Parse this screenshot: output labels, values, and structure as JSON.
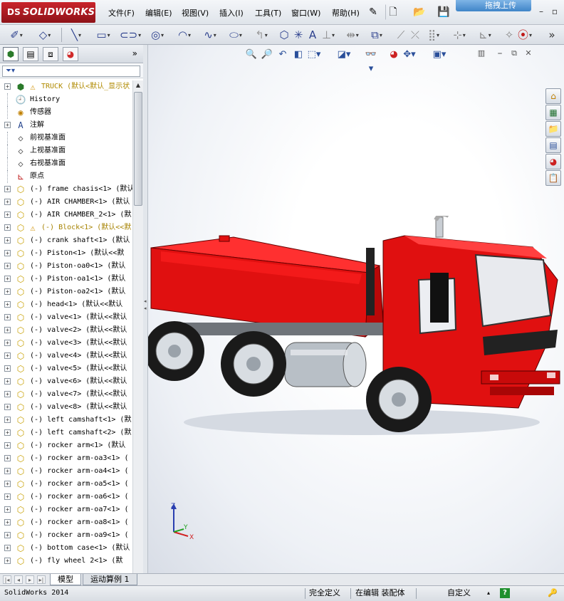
{
  "app": {
    "logo_text": "SOLIDWORKS",
    "logo_mark": "DS",
    "menu": [
      "文件(F)",
      "编辑(E)",
      "视图(V)",
      "插入(I)",
      "工具(T)",
      "窗口(W)",
      "帮助(H)"
    ],
    "upload_label": "拖拽上传"
  },
  "panel": {
    "tabs": [
      "feature-manager",
      "property-manager",
      "configuration-manager",
      "display-manager"
    ],
    "tree": [
      {
        "label": "TRUCK  (默认<默认_显示状",
        "icon": "assembly-icon",
        "warn": true,
        "root": true
      },
      {
        "label": "History",
        "icon": "history-icon"
      },
      {
        "label": "传感器",
        "icon": "sensor-icon"
      },
      {
        "label": "注解",
        "icon": "annotation-icon",
        "expand": true
      },
      {
        "label": "前视基准面",
        "icon": "plane-icon"
      },
      {
        "label": "上视基准面",
        "icon": "plane-icon"
      },
      {
        "label": "右视基准面",
        "icon": "plane-icon"
      },
      {
        "label": "原点",
        "icon": "origin-icon"
      },
      {
        "label": "(-) frame chasis<1> (默认",
        "icon": "part-icon",
        "expand": true
      },
      {
        "label": "(-) AIR CHAMBER<1> (默认",
        "icon": "part-icon",
        "expand": true
      },
      {
        "label": "(-) AIR CHAMBER_2<1> (默",
        "icon": "part-icon",
        "expand": true
      },
      {
        "label": "(-) Block<1> (默认<<默",
        "icon": "part-icon",
        "expand": true,
        "warn": true
      },
      {
        "label": "(-) crank shaft<1> (默认",
        "icon": "part-icon",
        "expand": true
      },
      {
        "label": "(-) Piston<1> (默认<<默",
        "icon": "part-icon",
        "expand": true
      },
      {
        "label": "(-) Piston-oa0<1> (默认",
        "icon": "part-icon",
        "expand": true
      },
      {
        "label": "(-) Piston-oa1<1> (默认",
        "icon": "part-icon",
        "expand": true
      },
      {
        "label": "(-) Piston-oa2<1> (默认",
        "icon": "part-icon",
        "expand": true
      },
      {
        "label": "(-) head<1> (默认<<默认",
        "icon": "part-icon",
        "expand": true
      },
      {
        "label": "(-) valve<1> (默认<<默认",
        "icon": "part-icon",
        "expand": true
      },
      {
        "label": "(-) valve<2> (默认<<默认",
        "icon": "part-icon",
        "expand": true
      },
      {
        "label": "(-) valve<3> (默认<<默认",
        "icon": "part-icon",
        "expand": true
      },
      {
        "label": "(-) valve<4> (默认<<默认",
        "icon": "part-icon",
        "expand": true
      },
      {
        "label": "(-) valve<5> (默认<<默认",
        "icon": "part-icon",
        "expand": true
      },
      {
        "label": "(-) valve<6> (默认<<默认",
        "icon": "part-icon",
        "expand": true
      },
      {
        "label": "(-) valve<7> (默认<<默认",
        "icon": "part-icon",
        "expand": true
      },
      {
        "label": "(-) valve<8> (默认<<默认",
        "icon": "part-icon",
        "expand": true
      },
      {
        "label": "(-) left camshaft<1> (默",
        "icon": "part-icon",
        "expand": true
      },
      {
        "label": "(-) left camshaft<2> (默",
        "icon": "part-icon",
        "expand": true
      },
      {
        "label": "(-) rocker arm<1> (默认",
        "icon": "part-icon",
        "expand": true
      },
      {
        "label": "(-) rocker arm-oa3<1> (",
        "icon": "part-icon",
        "expand": true
      },
      {
        "label": "(-) rocker arm-oa4<1> (",
        "icon": "part-icon",
        "expand": true
      },
      {
        "label": "(-) rocker arm-oa5<1> (",
        "icon": "part-icon",
        "expand": true
      },
      {
        "label": "(-) rocker arm-oa6<1> (",
        "icon": "part-icon",
        "expand": true
      },
      {
        "label": "(-) rocker arm-oa7<1> (",
        "icon": "part-icon",
        "expand": true
      },
      {
        "label": "(-) rocker arm-oa8<1> (",
        "icon": "part-icon",
        "expand": true
      },
      {
        "label": "(-) rocker arm-oa9<1> (",
        "icon": "part-icon",
        "expand": true
      },
      {
        "label": "(-) bottom case<1> (默认",
        "icon": "part-icon",
        "expand": true
      },
      {
        "label": "(-) fly wheel 2<1> (默",
        "icon": "part-icon",
        "expand": true
      }
    ]
  },
  "bottom": {
    "tabs": [
      "模型",
      "运动算例 1"
    ]
  },
  "status": {
    "app_version": "SolidWorks 2014",
    "definition": "完全定义",
    "editing": "在编辑 装配体",
    "units": "自定义",
    "help": "?"
  },
  "colors": {
    "truck_red": "#e01010",
    "accent_blue": "#2a4f9a"
  }
}
